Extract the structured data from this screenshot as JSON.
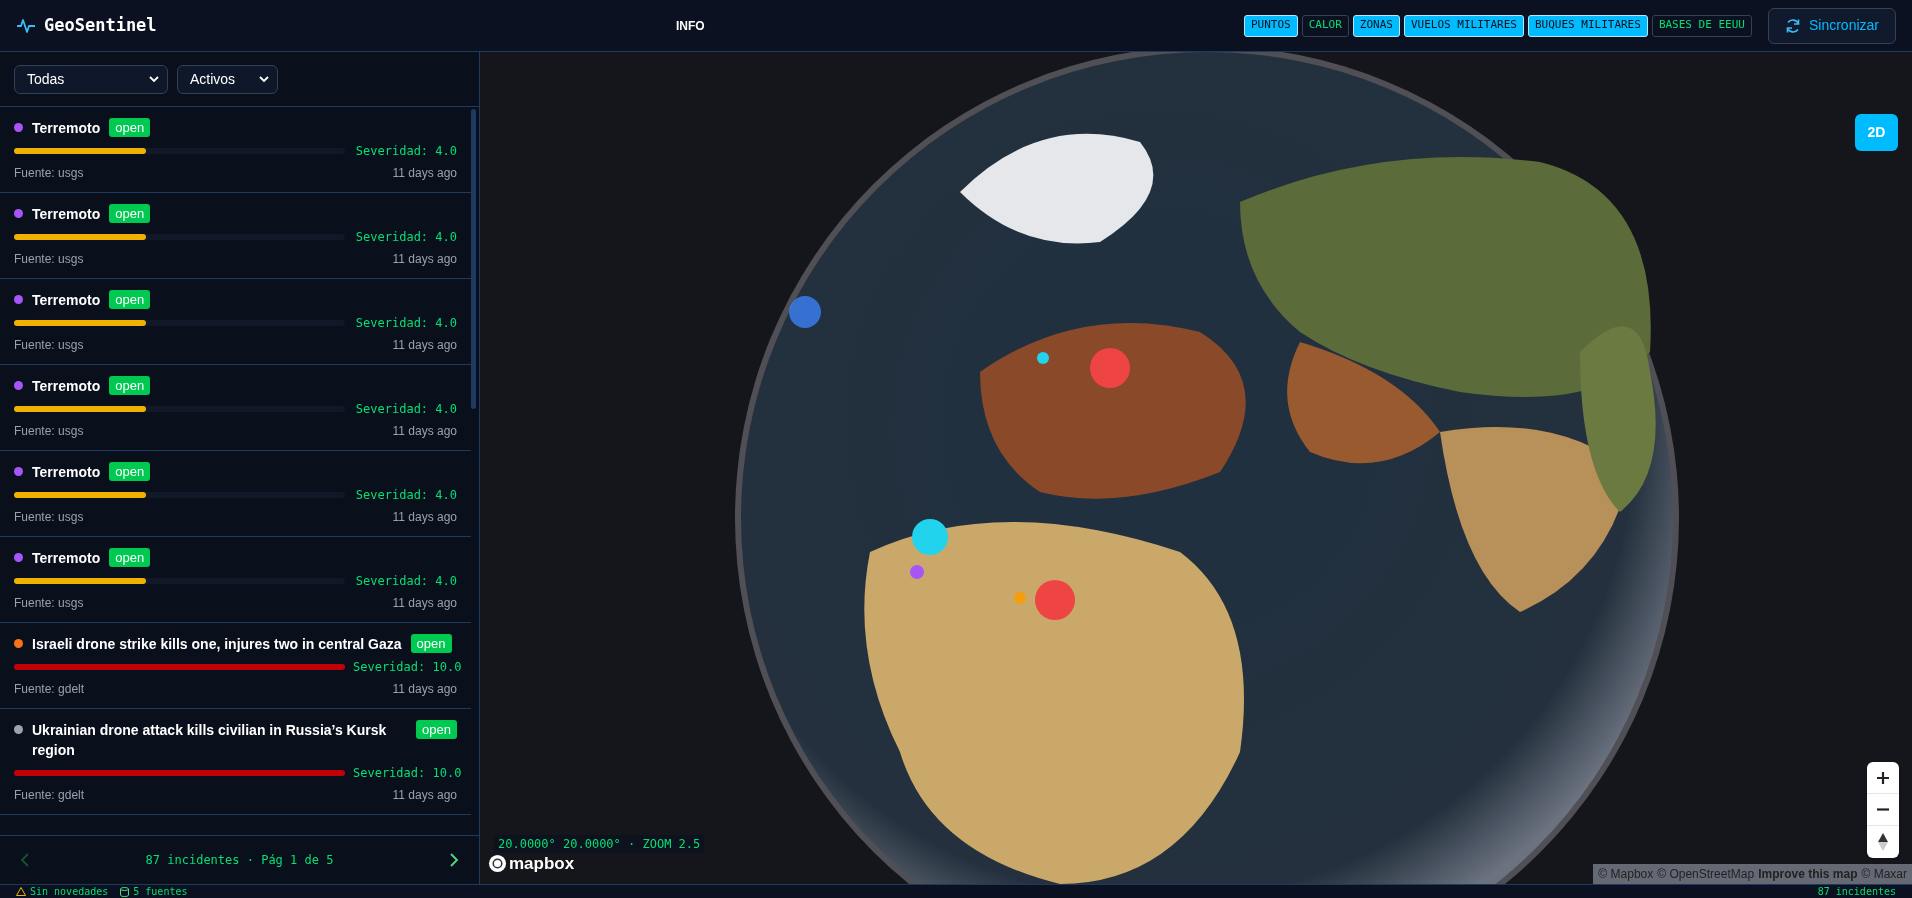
{
  "header": {
    "logo": "GeoSentinel",
    "center_label": "INFO",
    "layers": [
      {
        "label": "PUNTOS",
        "on": true
      },
      {
        "label": "CALOR",
        "on": false
      },
      {
        "label": "ZONAS",
        "on": true
      },
      {
        "label": "VUELOS MILITARES",
        "on": true
      },
      {
        "label": "BUQUES MILITARES",
        "on": true
      },
      {
        "label": "BASES DE EEUU",
        "on": false
      }
    ],
    "sync_button": "Sincronizar"
  },
  "filters": [
    {
      "value": "Todas"
    },
    {
      "value": "Activos"
    }
  ],
  "incidents": [
    {
      "title": "Terremoto",
      "color": "#a855f7",
      "status": "open",
      "level": 0.4,
      "severity": "Severidad: 4.0",
      "source": "Fuente: usgs",
      "time": "11 days ago"
    },
    {
      "title": "Terremoto",
      "color": "#a855f7",
      "status": "open",
      "level": 0.4,
      "severity": "Severidad: 4.0",
      "source": "Fuente: usgs",
      "time": "11 days ago"
    },
    {
      "title": "Terremoto",
      "color": "#a855f7",
      "status": "open",
      "level": 0.4,
      "severity": "Severidad: 4.0",
      "source": "Fuente: usgs",
      "time": "11 days ago"
    },
    {
      "title": "Terremoto",
      "color": "#a855f7",
      "status": "open",
      "level": 0.4,
      "severity": "Severidad: 4.0",
      "source": "Fuente: usgs",
      "time": "11 days ago"
    },
    {
      "title": "Terremoto",
      "color": "#a855f7",
      "status": "open",
      "level": 0.4,
      "severity": "Severidad: 4.0",
      "source": "Fuente: usgs",
      "time": "11 days ago"
    },
    {
      "title": "Terremoto",
      "color": "#a855f7",
      "status": "open",
      "level": 0.4,
      "severity": "Severidad: 4.0",
      "source": "Fuente: usgs",
      "time": "11 days ago"
    },
    {
      "title": "Israeli drone strike kills one, injures two in central Gaza",
      "color": "#f97316",
      "status": "open",
      "level": 1,
      "severity": "Severidad: 10.0",
      "source": "Fuente: gdelt",
      "time": "11 days ago"
    },
    {
      "title": "Ukrainian drone attack kills civilian in Russia’s Kursk region",
      "color": "#9ca3af",
      "status": "open",
      "level": 1,
      "severity": "Severidad: 10.0",
      "source": "Fuente: gdelt",
      "time": "11 days ago"
    }
  ],
  "pagination": {
    "text": "87 incidentes · Pág 1 de 5",
    "prev": {
      "disabled": true
    },
    "next": {
      "disabled": false
    }
  },
  "map": {
    "view_toggle": "2D",
    "coordinates": "20.0000° 20.0000° · ZOOM 2.5",
    "logo": "mapbox",
    "attribution": [
      "© Mapbox",
      "© OpenStreetMap",
      "Improve this map",
      "© Maxar"
    ]
  },
  "status_bar": {
    "alerts": "Sin novedades",
    "sources": "5 fuentes",
    "count": "87 incidentes"
  }
}
